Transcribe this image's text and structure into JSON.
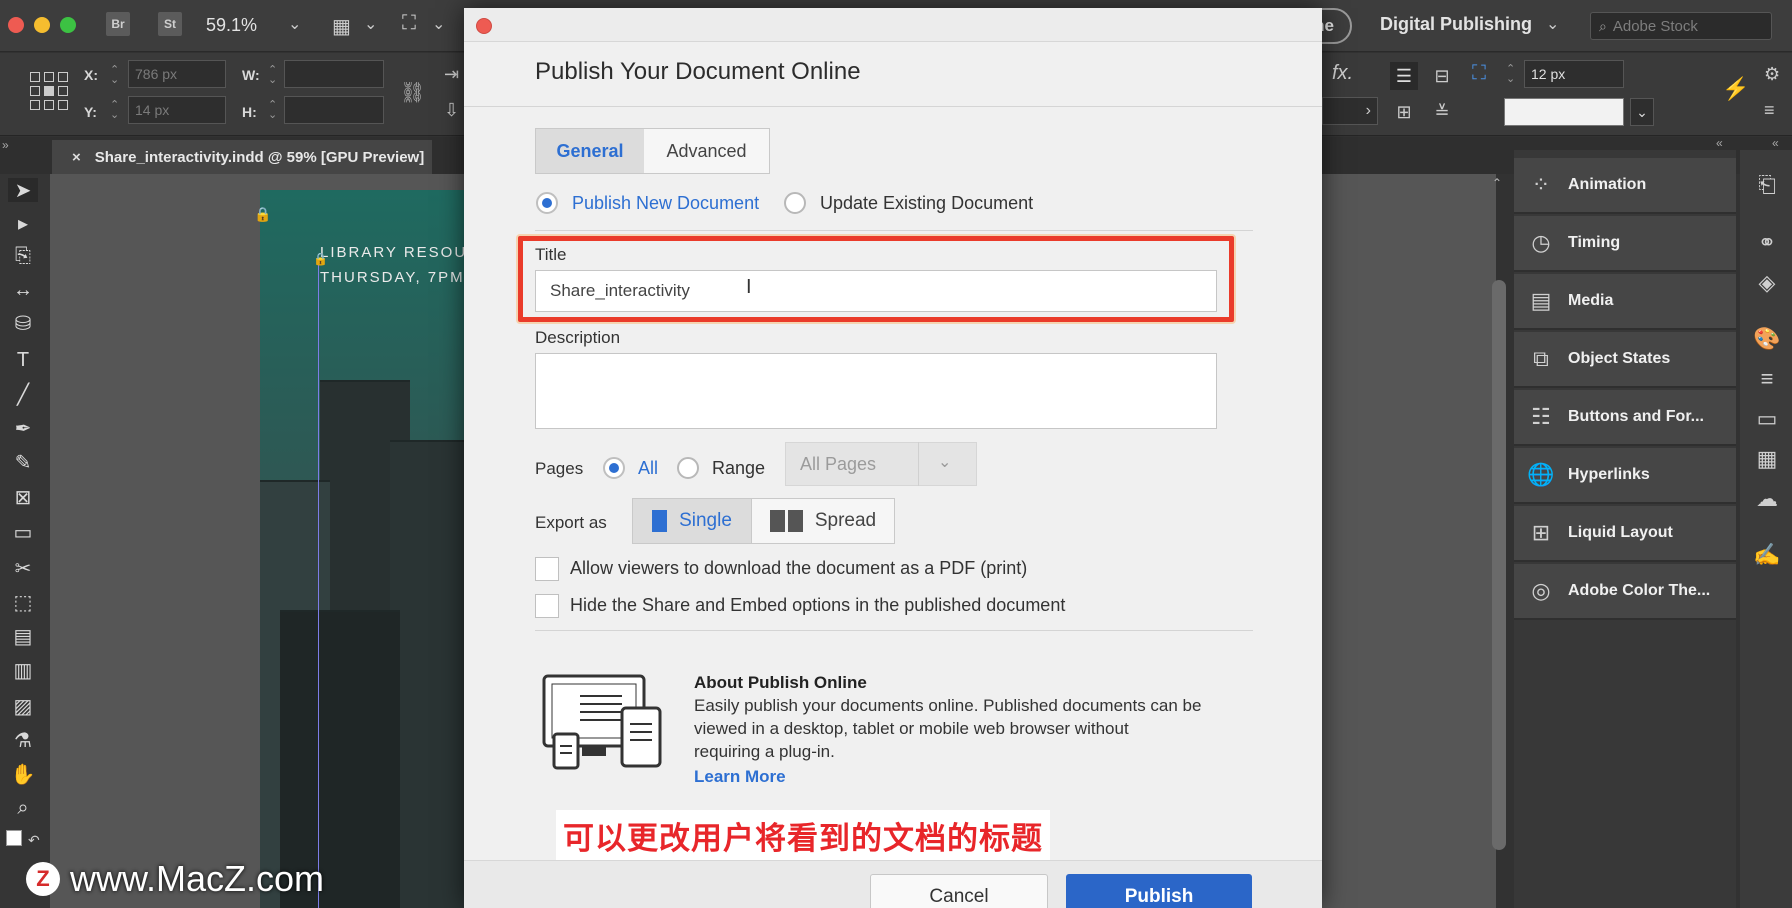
{
  "appbar": {
    "br_label": "Br",
    "st_label": "St",
    "zoom": "59.1%",
    "publish_online_btn_fragment": "ne",
    "workspace": "Digital Publishing",
    "search_placeholder": "Adobe Stock"
  },
  "controls": {
    "x_label": "X:",
    "x_value": "786 px",
    "y_label": "Y:",
    "y_value": "14 px",
    "w_label": "W:",
    "h_label": "H:",
    "fx_label": "fx.",
    "stroke_weight": "12 px"
  },
  "document_tab": {
    "close": "×",
    "label": "Share_interactivity.indd @ 59% [GPU Preview]"
  },
  "canvas": {
    "line1": "LIBRARY RESOU",
    "line2": "THURSDAY, 7PM"
  },
  "panels": [
    {
      "label": "Animation",
      "icon": "animation-icon"
    },
    {
      "label": "Timing",
      "icon": "timing-icon"
    },
    {
      "label": "Media",
      "icon": "media-icon"
    },
    {
      "label": "Object States",
      "icon": "object-states-icon"
    },
    {
      "label": "Buttons and For...",
      "icon": "buttons-forms-icon"
    },
    {
      "label": "Hyperlinks",
      "icon": "hyperlinks-icon"
    },
    {
      "label": "Liquid Layout",
      "icon": "liquid-layout-icon"
    },
    {
      "label": "Adobe Color The...",
      "icon": "adobe-color-icon"
    }
  ],
  "dialog": {
    "title": "Publish Your Document Online",
    "tabs": [
      "General",
      "Advanced"
    ],
    "mode_options": [
      "Publish New Document",
      "Update Existing Document"
    ],
    "title_label": "Title",
    "title_value": "Share_interactivity",
    "description_label": "Description",
    "description_value": "",
    "pages_label": "Pages",
    "pages_options": [
      "All",
      "Range"
    ],
    "pages_select": "All Pages",
    "export_label": "Export as",
    "export_options": [
      "Single",
      "Spread"
    ],
    "checkbox_pdf": "Allow viewers to download the document as a PDF (print)",
    "checkbox_share": "Hide the Share and Embed options in the published document",
    "about_title": "About Publish Online",
    "about_text_1": "Easily publish your documents online. Published documents can be",
    "about_text_2": "viewed in a desktop, tablet or mobile web browser without",
    "about_text_3": "requiring a plug-in.",
    "learn_more": "Learn More",
    "cancel": "Cancel",
    "publish": "Publish"
  },
  "overlay": {
    "subtitle": "可以更改用户将看到的文档的标题",
    "watermark": "www.MacZ.com",
    "watermark_logo": "Z"
  },
  "colors": {
    "accent": "#2d6fd2",
    "highlight": "#ea3b2a",
    "publish_button": "#2b66c8"
  }
}
